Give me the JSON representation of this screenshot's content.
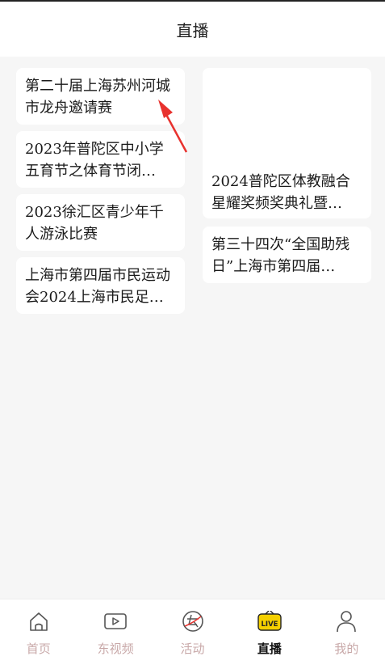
{
  "header": {
    "title": "直播"
  },
  "left_column": [
    {
      "title": "第二十届上海苏州河城市龙舟邀请赛"
    },
    {
      "title": "2023年普陀区中小学五育节之体育节闭…"
    },
    {
      "title": "2023徐汇区青少年千人游泳比赛"
    },
    {
      "title": "上海市第四届市民运动会2024上海市民足…"
    }
  ],
  "right_column": [
    {
      "title": "2024普陀区体教融合星耀奖频奖典礼暨…"
    },
    {
      "title": "第三十四次“全国助残日”上海市第四届…"
    }
  ],
  "annotation": {
    "color": "#e8322e"
  },
  "bottom_nav": {
    "items": [
      {
        "label": "首页",
        "icon": "home-icon",
        "active": false
      },
      {
        "label": "东视频",
        "icon": "video-icon",
        "active": false
      },
      {
        "label": "活动",
        "icon": "activity-icon",
        "active": false
      },
      {
        "label": "直播",
        "icon": "live-icon",
        "active": true
      },
      {
        "label": "我的",
        "icon": "profile-icon",
        "active": false
      }
    ],
    "active_color": "#111111",
    "inactive_color": "#c8a8a8",
    "live_badge_color": "#f5d000"
  }
}
